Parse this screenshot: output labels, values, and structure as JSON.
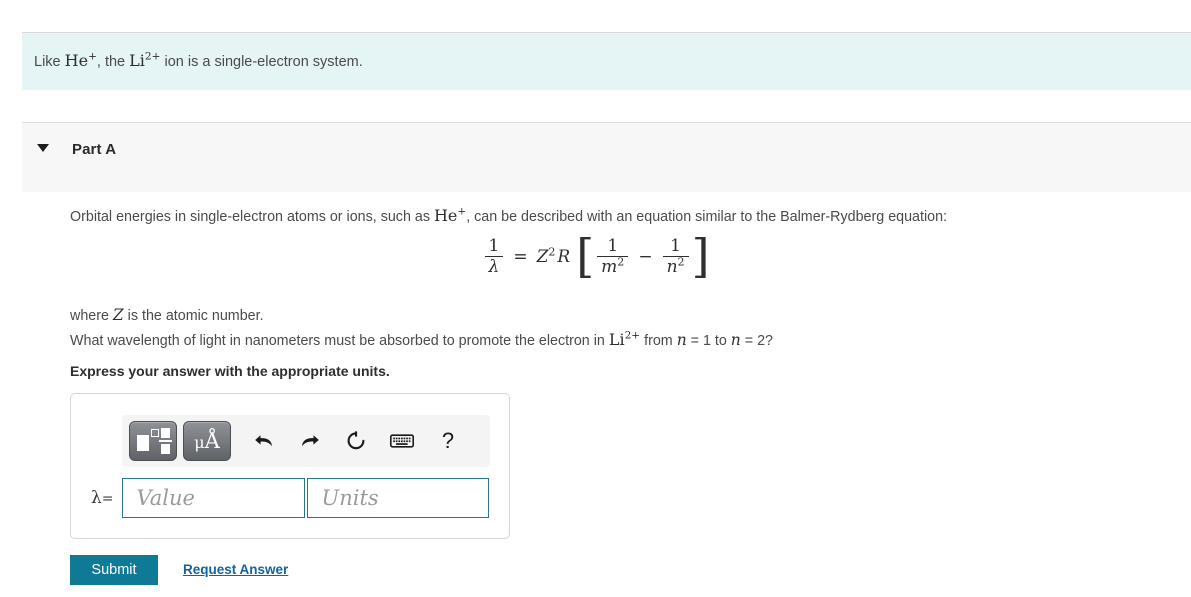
{
  "intro": {
    "text_before": "Like ",
    "he_symbol": "He",
    "he_charge": "+",
    "text_middle": ", the ",
    "li_symbol": "Li",
    "li_charge": "2+",
    "text_after": " ion is a single-electron system."
  },
  "part": {
    "caret_icon": "caret-down-icon",
    "title": "Part A"
  },
  "question": {
    "intro_before": "Orbital energies in single-electron atoms or ions, such as ",
    "intro_ion": "He",
    "intro_ion_charge": "+",
    "intro_after": ", can be described with an equation similar to the Balmer-Rydberg equation:",
    "where_before": "where ",
    "where_var": "Z",
    "where_after": " is the atomic number.",
    "prompt_before": "What wavelength of light in nanometers must be absorbed to promote the electron in ",
    "prompt_ion": "Li",
    "prompt_ion_charge": "2+",
    "prompt_mid": " from ",
    "prompt_n1": "n",
    "prompt_eq1": " = 1 to ",
    "prompt_n2": "n",
    "prompt_eq2": " = 2?",
    "express": "Express your answer with the appropriate units."
  },
  "equation": {
    "lhs_num": "1",
    "lhs_den": "λ",
    "equals": "=",
    "z": "Z",
    "z_exp": "2",
    "r": "R",
    "bracket_open": "[",
    "t1_num": "1",
    "t1_den": "m",
    "t1_den_exp": "2",
    "minus": "−",
    "t2_num": "1",
    "t2_den": "n",
    "t2_den_exp": "2",
    "bracket_close": "]"
  },
  "answer": {
    "toolbar": {
      "template_button": "template-icon",
      "units_button_mu": "μ",
      "units_button_a": "Å",
      "undo_icon": "undo-arrow-icon",
      "redo_icon": "redo-arrow-icon",
      "reset_icon": "reset-circular-arrow-icon",
      "keyboard_icon": "keyboard-icon",
      "help_label": "?"
    },
    "label": "λ",
    "label_equals": "=",
    "value_placeholder": "Value",
    "units_placeholder": "Units",
    "value_text": "",
    "units_text": ""
  },
  "actions": {
    "submit_label": "Submit",
    "request_answer_label": "Request Answer"
  },
  "colors": {
    "banner_bg": "#e5f4f4",
    "part_band_bg": "#f7f7f7",
    "submit_bg": "#0f7a96",
    "input_border": "#2b7489",
    "link": "#1064a0"
  }
}
